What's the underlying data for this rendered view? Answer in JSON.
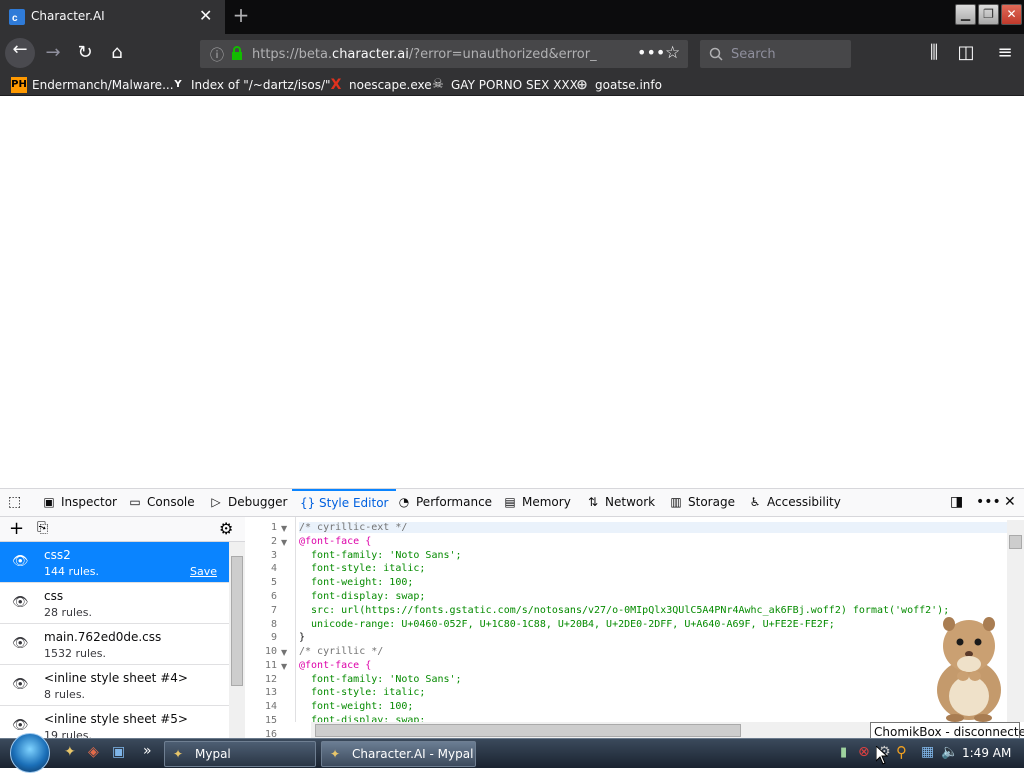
{
  "browser": {
    "tab_title": "Character.AI",
    "url_prefix": "https://beta.",
    "url_domain": "character.ai",
    "url_rest": "/?error=unauthorized&error_des",
    "search_placeholder": "Search"
  },
  "bookmarks": [
    {
      "label": "Endermanch/Malware...",
      "icon": "PH"
    },
    {
      "label": "Index of \"/~dartz/isos/\"",
      "icon": "Y"
    },
    {
      "label": "noescape.exe",
      "icon": "X"
    },
    {
      "label": "GAY PORNO SEX XXX",
      "icon": "ghost"
    },
    {
      "label": "goatse.info",
      "icon": "globe"
    }
  ],
  "devtools": {
    "tabs": [
      {
        "label": "Inspector",
        "icon": "inspector-icon"
      },
      {
        "label": "Console",
        "icon": "console-icon"
      },
      {
        "label": "Debugger",
        "icon": "debugger-icon"
      },
      {
        "label": "Style Editor",
        "icon": "style-editor-icon",
        "active": true
      },
      {
        "label": "Performance",
        "icon": "performance-icon"
      },
      {
        "label": "Memory",
        "icon": "memory-icon"
      },
      {
        "label": "Network",
        "icon": "network-icon"
      },
      {
        "label": "Storage",
        "icon": "storage-icon"
      },
      {
        "label": "Accessibility",
        "icon": "accessibility-icon"
      }
    ],
    "sheets": [
      {
        "name": "css2",
        "rules": "144 rules.",
        "save": "Save",
        "selected": true
      },
      {
        "name": "css",
        "rules": "28 rules."
      },
      {
        "name": "main.762ed0de.css",
        "rules": "1532 rules."
      },
      {
        "name": "<inline style sheet #4>",
        "rules": "8 rules."
      },
      {
        "name": "<inline style sheet #5>",
        "rules": "19 rules."
      }
    ],
    "code_lines": [
      "/* cyrillic-ext */",
      "@font-face {",
      "  font-family: 'Noto Sans';",
      "  font-style: italic;",
      "  font-weight: 100;",
      "  font-display: swap;",
      "  src: url(https://fonts.gstatic.com/s/notosans/v27/o-0MIpQlx3QUlC5A4PNr4Awhc_ak6FBj.woff2) format('woff2');",
      "  unicode-range: U+0460-052F, U+1C80-1C88, U+20B4, U+2DE0-2DFF, U+A640-A69F, U+FE2E-FE2F;",
      "}",
      "/* cyrillic */",
      "@font-face {",
      "  font-family: 'Noto Sans';",
      "  font-style: italic;",
      "  font-weight: 100;",
      "  font-display: swap;",
      ""
    ]
  },
  "taskbar": {
    "tasks": [
      "Mypal",
      "Character.AI - Mypal"
    ],
    "clock": "1:49 AM",
    "tooltip": "ChomikBox - disconnected"
  }
}
